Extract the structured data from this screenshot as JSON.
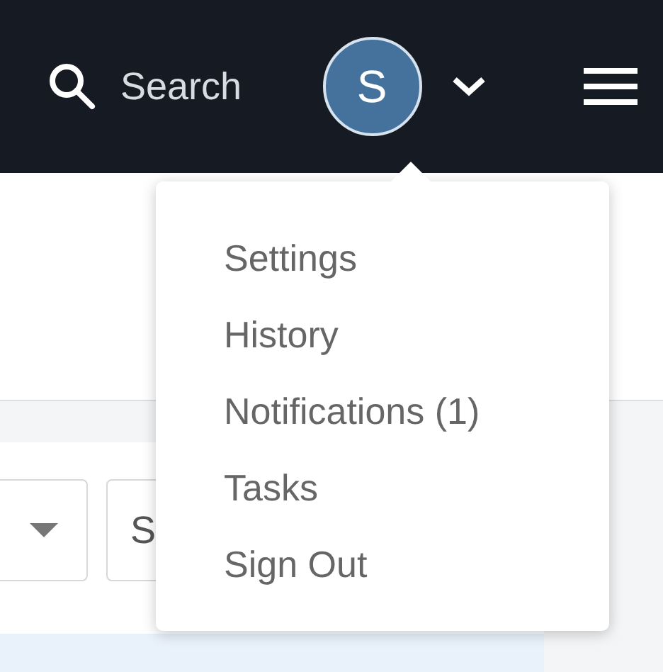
{
  "navbar": {
    "search": {
      "label": "Search"
    },
    "avatar": {
      "initial": "S"
    }
  },
  "user_menu": {
    "items": [
      {
        "label": "Settings"
      },
      {
        "label": "History"
      },
      {
        "label": "Notifications (1)"
      },
      {
        "label": "Tasks"
      },
      {
        "label": "Sign Out"
      }
    ]
  },
  "filters": {
    "field_2": {
      "value": "S"
    }
  }
}
